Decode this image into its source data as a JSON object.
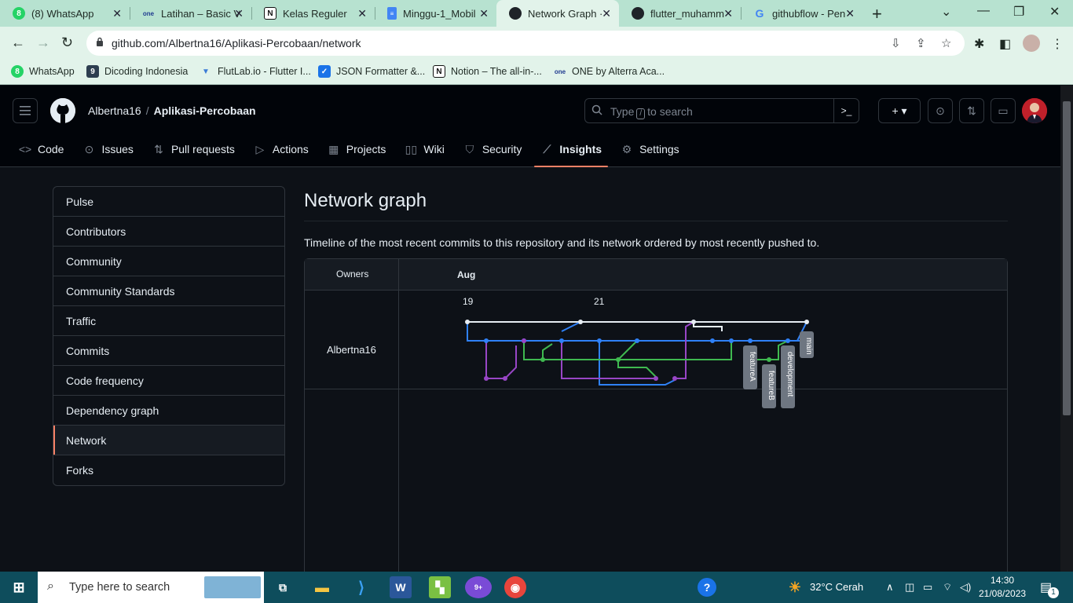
{
  "browser": {
    "tabs": [
      {
        "title": "(8) WhatsApp",
        "icon": "whatsapp-icon"
      },
      {
        "title": "Latihan – Basic Vi",
        "icon": "alterra-icon"
      },
      {
        "title": "Kelas Reguler",
        "icon": "notion-icon"
      },
      {
        "title": "Minggu-1_Mobil",
        "icon": "docs-icon"
      },
      {
        "title": "Network Graph ·",
        "icon": "github-icon"
      },
      {
        "title": "flutter_muhamm",
        "icon": "github-icon"
      },
      {
        "title": "githubflow - Pen",
        "icon": "google-icon"
      }
    ],
    "new_tab_label": "+",
    "url": "github.com/Albertna16/Aplikasi-Percobaan/network",
    "bookmarks": [
      {
        "label": "WhatsApp",
        "icon": "whatsapp-icon"
      },
      {
        "label": "Dicoding Indonesia",
        "icon": "dicoding-icon"
      },
      {
        "label": "FlutLab.io - Flutter I...",
        "icon": "flutlab-icon"
      },
      {
        "label": "JSON Formatter &...",
        "icon": "json-formatter-icon"
      },
      {
        "label": "Notion – The all-in-...",
        "icon": "notion-icon"
      },
      {
        "label": "ONE by Alterra Aca...",
        "icon": "alterra-icon"
      }
    ]
  },
  "github": {
    "owner": "Albertna16",
    "separator": "/",
    "repo": "Aplikasi-Percobaan",
    "search": {
      "before": "Type",
      "key": "/",
      "after": "to search"
    },
    "nav": [
      {
        "label": "Code",
        "icon": "code-icon"
      },
      {
        "label": "Issues",
        "icon": "issue-icon"
      },
      {
        "label": "Pull requests",
        "icon": "pull-request-icon"
      },
      {
        "label": "Actions",
        "icon": "actions-icon"
      },
      {
        "label": "Projects",
        "icon": "projects-icon"
      },
      {
        "label": "Wiki",
        "icon": "book-icon"
      },
      {
        "label": "Security",
        "icon": "shield-icon"
      },
      {
        "label": "Insights",
        "icon": "graph-icon",
        "selected": true
      },
      {
        "label": "Settings",
        "icon": "gear-icon"
      }
    ]
  },
  "insights": {
    "menu": [
      "Pulse",
      "Contributors",
      "Community",
      "Community Standards",
      "Traffic",
      "Commits",
      "Code frequency",
      "Dependency graph",
      "Network",
      "Forks"
    ],
    "selected": "Network"
  },
  "page": {
    "title": "Network graph",
    "description": "Timeline of the most recent commits to this repository and its network ordered by most recently pushed to."
  },
  "network_graph": {
    "owners_header": "Owners",
    "month": "Aug",
    "days": [
      "19",
      "21"
    ],
    "owner": "Albertna16",
    "branches": [
      {
        "name": "main",
        "color": "#2f81f7"
      },
      {
        "name": "featureA",
        "color": "#9846c6"
      },
      {
        "name": "featureB",
        "color": "#3fb950"
      },
      {
        "name": "development",
        "color": "#2f81f7"
      }
    ],
    "colors": {
      "white": "#e6edf3",
      "blue": "#2f81f7",
      "purple": "#9846c6",
      "green": "#3fb950"
    }
  },
  "taskbar": {
    "search_placeholder": "Type here to search",
    "weather": {
      "temp": "32°C",
      "condition": "Cerah"
    },
    "time": "14:30",
    "date": "21/08/2023",
    "notification_count": "1",
    "messenger_badge": "9+"
  }
}
